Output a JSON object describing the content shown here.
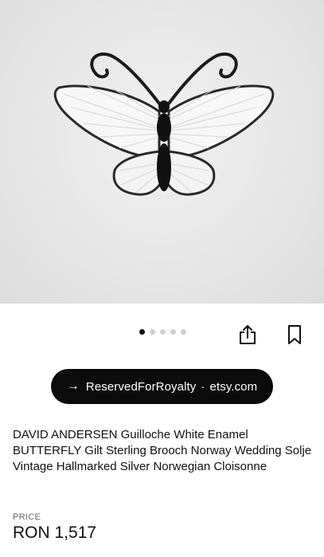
{
  "product": {
    "image_alt": "White enamel butterfly brooch",
    "gallery": {
      "total": 5,
      "active_index": 0
    },
    "shop_button": {
      "arrow": "→",
      "shop_name": "ReservedForRoyalty",
      "separator": "·",
      "domain": "etsy.com"
    },
    "title": "DAVID ANDERSEN Guilloche White Enamel BUTTERFLY Gilt Sterling Brooch Norway Wedding Solje Vintage Hallmarked Silver Norwegian Cloisonne",
    "price_label": "PRICE",
    "price": "RON 1,517"
  },
  "icons": {
    "share": "share-icon",
    "bookmark": "bookmark-icon"
  },
  "colors": {
    "pill_bg": "#0b0b0b",
    "active_dot": "#111111",
    "inactive_dot": "#d0d0d0"
  }
}
